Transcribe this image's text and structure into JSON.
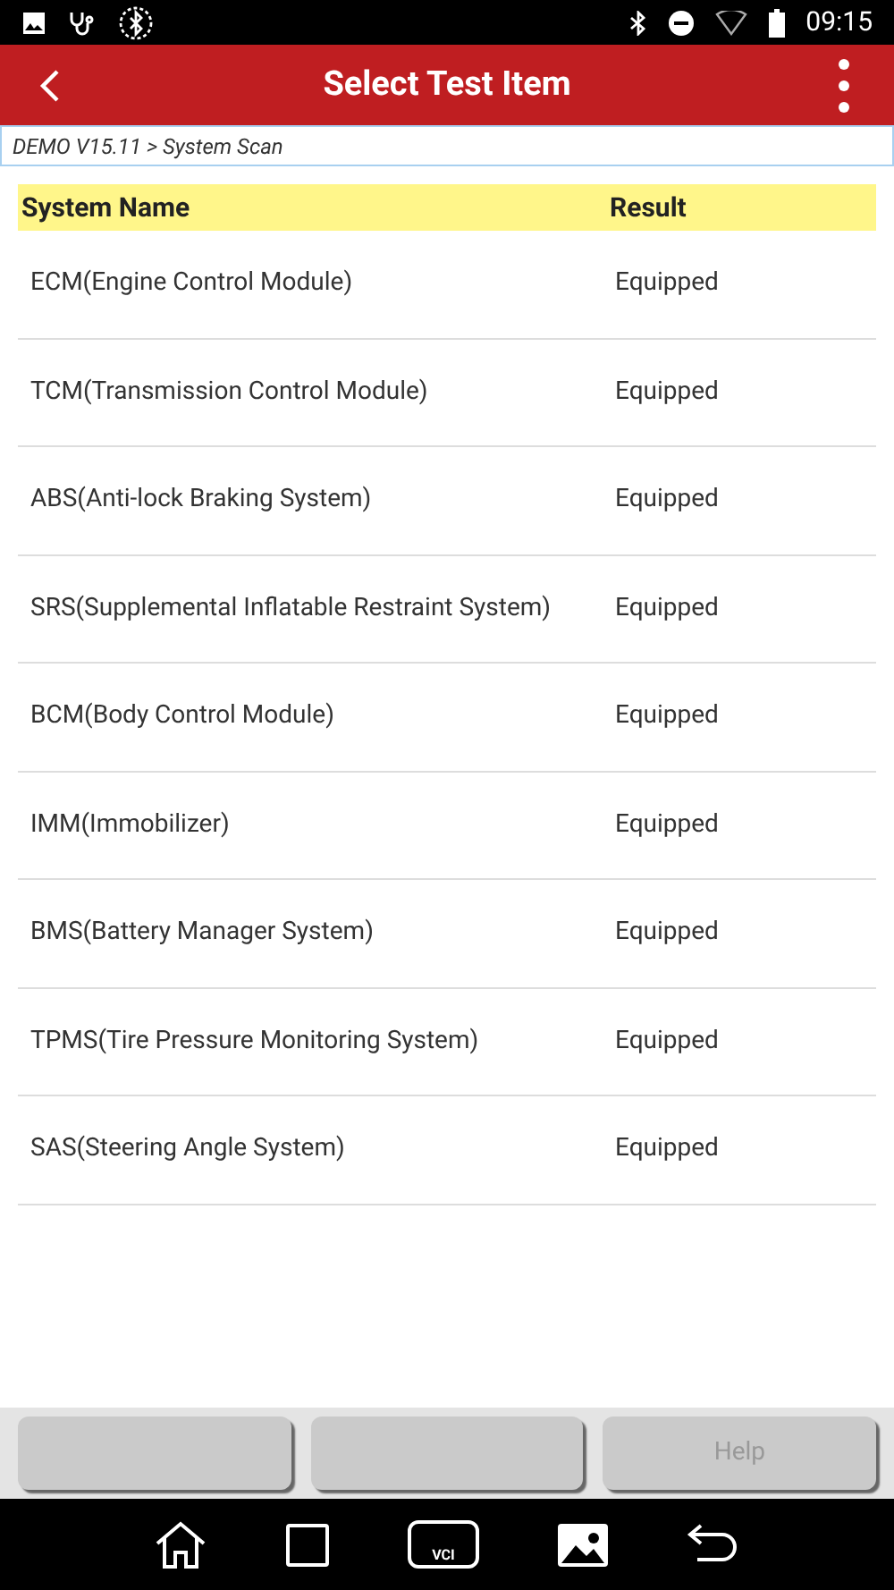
{
  "status_bar": {
    "time": "09:15"
  },
  "header": {
    "title": "Select Test Item"
  },
  "breadcrumb": "DEMO V15.11 > System Scan",
  "table": {
    "columns": [
      "System Name",
      "Result"
    ],
    "rows": [
      {
        "name": "ECM(Engine Control Module)",
        "result": "Equipped"
      },
      {
        "name": "TCM(Transmission Control Module)",
        "result": "Equipped"
      },
      {
        "name": "ABS(Anti-lock Braking System)",
        "result": "Equipped"
      },
      {
        "name": "SRS(Supplemental Inflatable Restraint System)",
        "result": "Equipped"
      },
      {
        "name": "BCM(Body Control Module)",
        "result": "Equipped"
      },
      {
        "name": "IMM(Immobilizer)",
        "result": "Equipped"
      },
      {
        "name": "BMS(Battery Manager System)",
        "result": "Equipped"
      },
      {
        "name": "TPMS(Tire Pressure Monitoring System)",
        "result": "Equipped"
      },
      {
        "name": "SAS(Steering Angle System)",
        "result": "Equipped"
      }
    ]
  },
  "bottom_buttons": [
    {
      "kind": "blank"
    },
    {
      "kind": "blank"
    },
    {
      "kind": "labeled",
      "label": "Help"
    }
  ],
  "nav_bar": {
    "vci_label": "VCI"
  }
}
